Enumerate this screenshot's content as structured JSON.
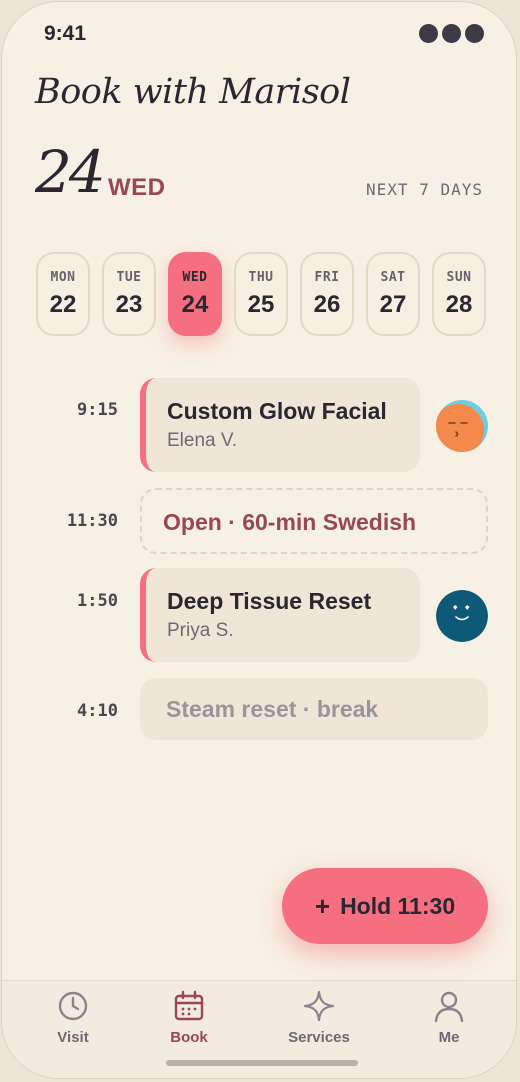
{
  "status": {
    "time": "9:41"
  },
  "header": {
    "title": "Book with Marisol",
    "day_number": "24",
    "weekday": "WED",
    "range_label": "NEXT 7 DAYS"
  },
  "days": [
    {
      "dow": "MON",
      "num": "22"
    },
    {
      "dow": "TUE",
      "num": "23"
    },
    {
      "dow": "WED",
      "num": "24",
      "selected": true
    },
    {
      "dow": "THU",
      "num": "25"
    },
    {
      "dow": "FRI",
      "num": "26"
    },
    {
      "dow": "SAT",
      "num": "27"
    },
    {
      "dow": "SUN",
      "num": "28"
    }
  ],
  "schedule": [
    {
      "time": "9:15",
      "type": "appointment",
      "service": "Custom Glow Facial",
      "client": "Elena V."
    },
    {
      "time": "11:30",
      "type": "open",
      "label": "Open · 60-min Swedish"
    },
    {
      "time": "1:50",
      "type": "appointment",
      "service": "Deep Tissue Reset",
      "client": "Priya S."
    },
    {
      "time": "4:10",
      "type": "break",
      "label": "Steam reset · break"
    }
  ],
  "fab": {
    "label": "Hold 11:30",
    "icon": "plus-icon"
  },
  "tabs": [
    {
      "label": "Visit",
      "icon": "clock-icon"
    },
    {
      "label": "Book",
      "icon": "calendar-icon",
      "active": true
    },
    {
      "label": "Services",
      "icon": "sparkle-icon"
    },
    {
      "label": "Me",
      "icon": "person-icon"
    }
  ],
  "colors": {
    "accent": "#f56f80",
    "accent_text": "#9a4558",
    "background": "#f7f0e4",
    "card": "#efe6d8"
  }
}
